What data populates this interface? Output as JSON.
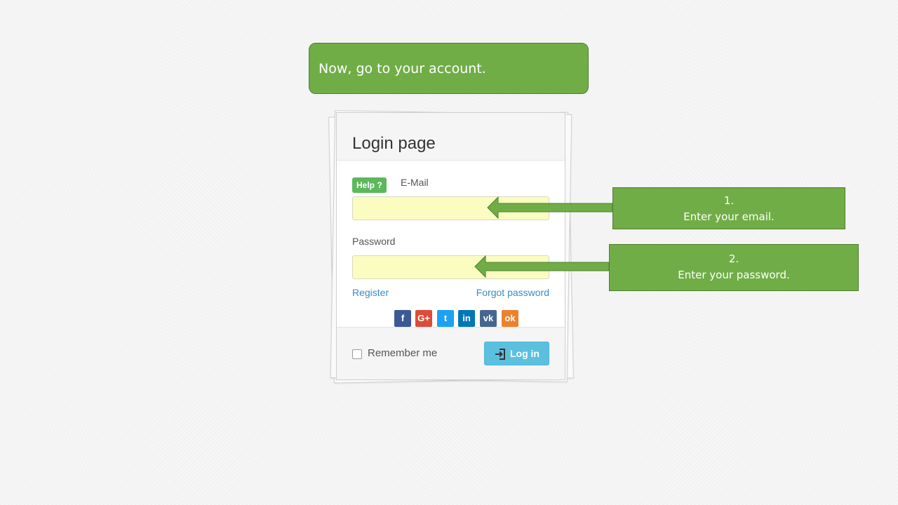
{
  "callout_top": {
    "text": "Now, go to your account."
  },
  "login": {
    "title": "Login page",
    "help_badge": "Help ?",
    "email_label": "E-Mail",
    "email_value": "",
    "password_label": "Password",
    "password_value": "",
    "register_link": "Register",
    "forgot_link": "Forgot password",
    "social_buttons": [
      {
        "name": "facebook",
        "glyph": "f",
        "color": "#3b5998"
      },
      {
        "name": "google-plus",
        "glyph": "G+",
        "color": "#dd4b39"
      },
      {
        "name": "twitter",
        "glyph": "t",
        "color": "#1da1f2"
      },
      {
        "name": "linkedin",
        "glyph": "in",
        "color": "#0077b5"
      },
      {
        "name": "vk",
        "glyph": "vk",
        "color": "#45668e"
      },
      {
        "name": "odnoklassniki",
        "glyph": "ok",
        "color": "#ed812b"
      }
    ],
    "remember_label": "Remember me",
    "remember_checked": false,
    "login_button": "Log in"
  },
  "steps": [
    {
      "number": "1.",
      "text": "Enter your email."
    },
    {
      "number": "2.",
      "text": "Enter your password."
    }
  ],
  "colors": {
    "callout_green": "#70ad47",
    "input_highlight": "#fbfcc0",
    "link_blue": "#3a8ac7",
    "login_button": "#5bc0de",
    "help_badge": "#5cb85c"
  }
}
